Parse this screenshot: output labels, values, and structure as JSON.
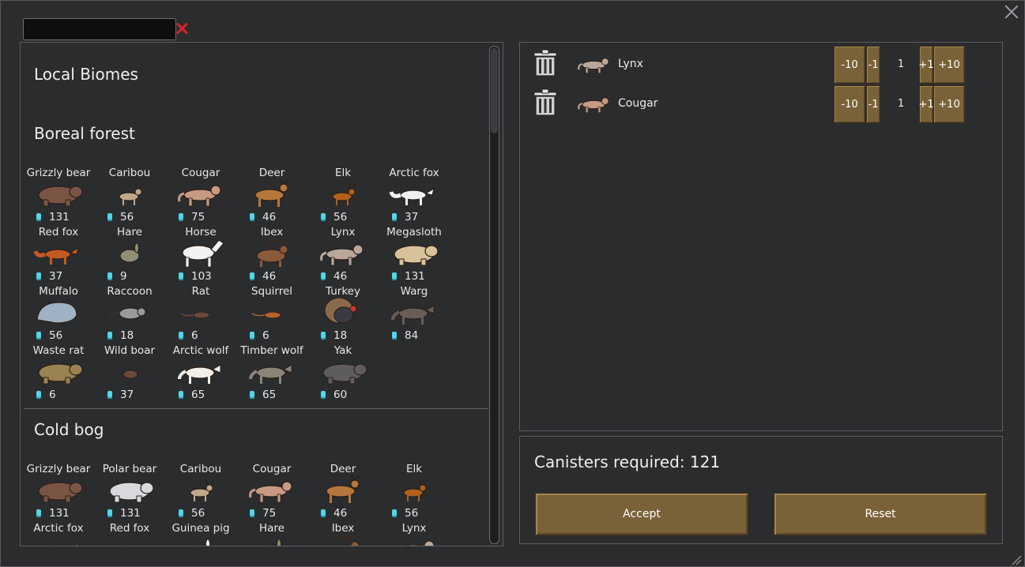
{
  "window": {
    "close_icon": "close-icon"
  },
  "search": {
    "value": "",
    "placeholder": ""
  },
  "biomes": [
    {
      "name": "Local Biomes",
      "animals": []
    },
    {
      "name": "Boreal forest",
      "animals": [
        {
          "name": "Grizzly bear",
          "cost": "131",
          "color": "#7a5546",
          "shape": "bear"
        },
        {
          "name": "Caribou",
          "cost": "56",
          "color": "#c2a78a",
          "shape": "deer-small"
        },
        {
          "name": "Cougar",
          "cost": "75",
          "color": "#c89a82",
          "shape": "cat"
        },
        {
          "name": "Deer",
          "cost": "46",
          "color": "#b7773c",
          "shape": "deer"
        },
        {
          "name": "Elk",
          "cost": "56",
          "color": "#b1611a",
          "shape": "deer-small"
        },
        {
          "name": "Arctic fox",
          "cost": "37",
          "color": "#f0f0f2",
          "shape": "fox"
        },
        {
          "name": "Red fox",
          "cost": "37",
          "color": "#c55a22",
          "shape": "fox"
        },
        {
          "name": "Hare",
          "cost": "9",
          "color": "#8e8f74",
          "shape": "hare"
        },
        {
          "name": "Horse",
          "cost": "103",
          "color": "#f2f2f2",
          "shape": "horse"
        },
        {
          "name": "Ibex",
          "cost": "46",
          "color": "#8a5a3a",
          "shape": "ibex"
        },
        {
          "name": "Lynx",
          "cost": "46",
          "color": "#b9a79a",
          "shape": "cat"
        },
        {
          "name": "Megasloth",
          "cost": "131",
          "color": "#d8c29a",
          "shape": "bear"
        },
        {
          "name": "Muffalo",
          "cost": "56",
          "color": "#9fb1c2",
          "shape": "muffalo"
        },
        {
          "name": "Raccoon",
          "cost": "18",
          "color": "#9a9a9a",
          "shape": "raccoon"
        },
        {
          "name": "Rat",
          "cost": "6",
          "color": "#6b4a3c",
          "shape": "rat"
        },
        {
          "name": "Squirrel",
          "cost": "6",
          "color": "#b7622a",
          "shape": "rat"
        },
        {
          "name": "Turkey",
          "cost": "18",
          "color": "#3a3a44",
          "shape": "turkey"
        },
        {
          "name": "Warg",
          "cost": "84",
          "color": "#6a5d56",
          "shape": "wolf"
        },
        {
          "name": "Waste rat",
          "cost": "6",
          "color": "#9a8352",
          "shape": "bear"
        },
        {
          "name": "Wild boar",
          "cost": "37",
          "color": "#6b4a3c",
          "shape": "boar"
        },
        {
          "name": "Arctic wolf",
          "cost": "65",
          "color": "#f2efe8",
          "shape": "wolf"
        },
        {
          "name": "Timber wolf",
          "cost": "65",
          "color": "#8a8478",
          "shape": "wolf"
        },
        {
          "name": "Yak",
          "cost": "60",
          "color": "#5e5c5e",
          "shape": "bear"
        }
      ]
    },
    {
      "name": "Cold bog",
      "animals": [
        {
          "name": "Grizzly bear",
          "cost": "131",
          "color": "#7a5546",
          "shape": "bear"
        },
        {
          "name": "Polar bear",
          "cost": "131",
          "color": "#d8d9dc",
          "shape": "bear"
        },
        {
          "name": "Caribou",
          "cost": "56",
          "color": "#c2a78a",
          "shape": "deer-small"
        },
        {
          "name": "Cougar",
          "cost": "75",
          "color": "#c89a82",
          "shape": "cat"
        },
        {
          "name": "Deer",
          "cost": "46",
          "color": "#b7773c",
          "shape": "deer"
        },
        {
          "name": "Elk",
          "cost": "56",
          "color": "#b1611a",
          "shape": "deer-small"
        },
        {
          "name": "Arctic fox",
          "cost": "",
          "color": "#f0f0f2",
          "shape": "fox"
        },
        {
          "name": "Red fox",
          "cost": "",
          "color": "#c55a22",
          "shape": "fox"
        },
        {
          "name": "Guinea pig",
          "cost": "",
          "color": "#f2f2f2",
          "shape": "hare"
        },
        {
          "name": "Hare",
          "cost": "",
          "color": "#8e8f74",
          "shape": "hare"
        },
        {
          "name": "Ibex",
          "cost": "",
          "color": "#8a5a3a",
          "shape": "ibex"
        },
        {
          "name": "Lynx",
          "cost": "",
          "color": "#b9a79a",
          "shape": "cat"
        }
      ]
    }
  ],
  "selection": [
    {
      "name": "Lynx",
      "count": "1",
      "color": "#b9a79a",
      "shape": "cat"
    },
    {
      "name": "Cougar",
      "count": "1",
      "color": "#c89a82",
      "shape": "cat"
    }
  ],
  "qty_buttons": {
    "minus10": "-10",
    "minus1": "-1",
    "plus1": "+1",
    "plus10": "+10"
  },
  "summary": {
    "canisters_label": "Canisters required: 121"
  },
  "buttons": {
    "accept": "Accept",
    "reset": "Reset"
  }
}
